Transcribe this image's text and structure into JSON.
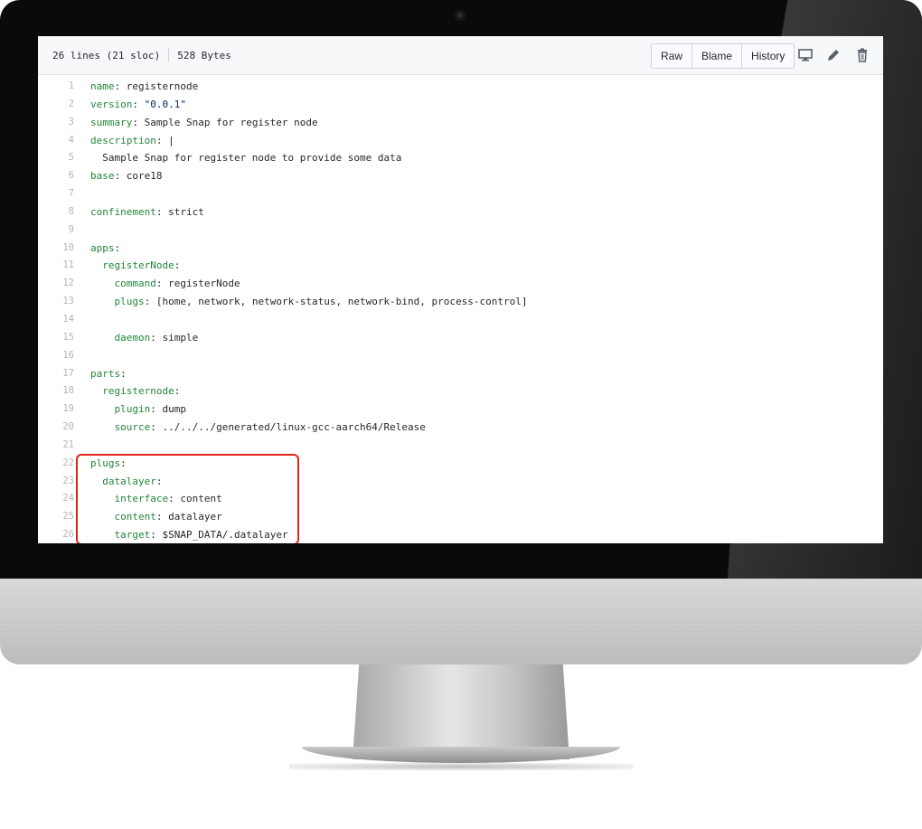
{
  "file_header": {
    "lines_info": "26 lines (21 sloc)",
    "size_info": "528 Bytes",
    "buttons": [
      "Raw",
      "Blame",
      "History"
    ],
    "icons": [
      "desktop-icon",
      "pencil-icon",
      "trash-icon"
    ]
  },
  "code_lines": [
    {
      "n": "1",
      "key": "name",
      "val": " registernode"
    },
    {
      "n": "2",
      "key": "version",
      "val": " \"0.0.1\""
    },
    {
      "n": "3",
      "key": "summary",
      "val": " Sample Snap for register node"
    },
    {
      "n": "4",
      "key": "description",
      "val": " |"
    },
    {
      "n": "5",
      "key": "",
      "val": "  Sample Snap for register node to provide some data"
    },
    {
      "n": "6",
      "key": "base",
      "val": " core18"
    },
    {
      "n": "7",
      "key": "",
      "val": ""
    },
    {
      "n": "8",
      "key": "confinement",
      "val": " strict"
    },
    {
      "n": "9",
      "key": "",
      "val": ""
    },
    {
      "n": "10",
      "key": "apps",
      "val": ""
    },
    {
      "n": "11",
      "indent": "  ",
      "key": "registerNode",
      "val": ""
    },
    {
      "n": "12",
      "indent": "    ",
      "key": "command",
      "val": " registerNode"
    },
    {
      "n": "13",
      "indent": "    ",
      "key": "plugs",
      "val": " [home, network, network-status, network-bind, process-control]"
    },
    {
      "n": "14",
      "key": "",
      "val": ""
    },
    {
      "n": "15",
      "indent": "    ",
      "key": "daemon",
      "val": " simple"
    },
    {
      "n": "16",
      "key": "",
      "val": ""
    },
    {
      "n": "17",
      "key": "parts",
      "val": ""
    },
    {
      "n": "18",
      "indent": "  ",
      "key": "registernode",
      "val": ""
    },
    {
      "n": "19",
      "indent": "    ",
      "key": "plugin",
      "val": " dump"
    },
    {
      "n": "20",
      "indent": "    ",
      "key": "source",
      "val": " ../../../generated/linux-gcc-aarch64/Release"
    },
    {
      "n": "21",
      "key": "",
      "val": ""
    },
    {
      "n": "22",
      "key": "plugs",
      "val": ""
    },
    {
      "n": "23",
      "indent": "  ",
      "key": "datalayer",
      "val": ""
    },
    {
      "n": "24",
      "indent": "    ",
      "key": "interface",
      "val": " content"
    },
    {
      "n": "25",
      "indent": "    ",
      "key": "content",
      "val": " datalayer"
    },
    {
      "n": "26",
      "indent": "    ",
      "key": "target",
      "val": " $SNAP_DATA/.datalayer"
    }
  ],
  "colors": {
    "key": "#22863a",
    "string": "#032f62",
    "highlight_border": "#e32219"
  }
}
